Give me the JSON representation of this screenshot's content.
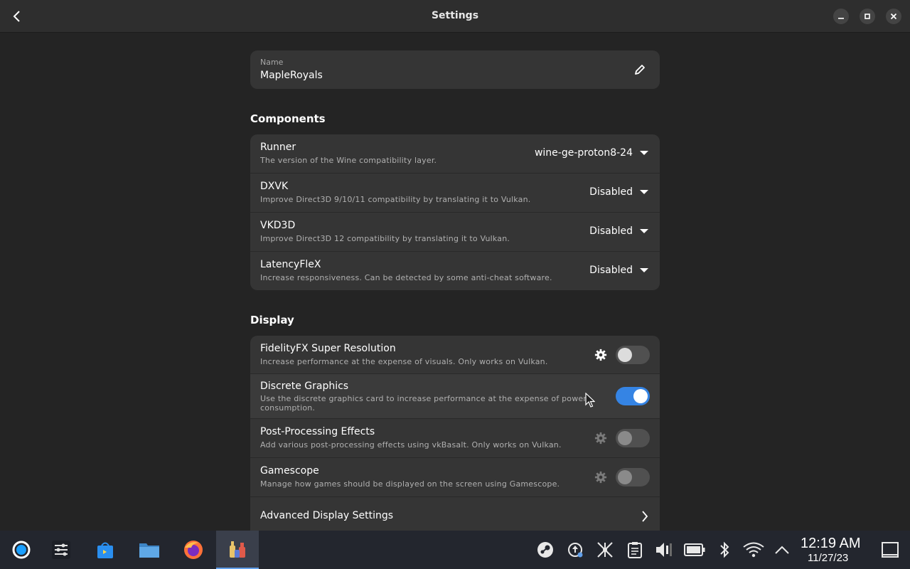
{
  "window": {
    "title": "Settings"
  },
  "name_field": {
    "label": "Name",
    "value": "MapleRoyals"
  },
  "components": {
    "heading": "Components",
    "rows": [
      {
        "title": "Runner",
        "subtitle": "The version of the Wine compatibility layer.",
        "value": "wine-ge-proton8-24"
      },
      {
        "title": "DXVK",
        "subtitle": "Improve Direct3D 9/10/11 compatibility by translating it to Vulkan.",
        "value": "Disabled"
      },
      {
        "title": "VKD3D",
        "subtitle": "Improve Direct3D 12 compatibility by translating it to Vulkan.",
        "value": "Disabled"
      },
      {
        "title": "LatencyFleX",
        "subtitle": "Increase responsiveness. Can be detected by some anti-cheat software.",
        "value": "Disabled"
      }
    ]
  },
  "display": {
    "heading": "Display",
    "rows": [
      {
        "title": "FidelityFX Super Resolution",
        "subtitle": "Increase performance at the expense of visuals. Only works on Vulkan.",
        "enabled": false
      },
      {
        "title": "Discrete Graphics",
        "subtitle": "Use the discrete graphics card to increase performance at the expense of power consumption.",
        "enabled": true
      },
      {
        "title": "Post-Processing Effects",
        "subtitle": "Add various post-processing effects using vkBasalt. Only works on Vulkan.",
        "enabled": false
      },
      {
        "title": "Gamescope",
        "subtitle": "Manage how games should be displayed on the screen using Gamescope.",
        "enabled": false
      }
    ],
    "advanced_label": "Advanced Display Settings"
  },
  "taskbar": {
    "apps": [
      "steam-launcher-icon",
      "settings-sliders-icon",
      "store-icon",
      "file-manager-icon",
      "firefox-icon",
      "bottles-icon"
    ],
    "tray": [
      "steam-icon",
      "update-icon",
      "network-share-icon",
      "clipboard-icon",
      "volume-icon",
      "battery-icon",
      "bluetooth-icon",
      "wifi-icon",
      "chevron-up-icon"
    ],
    "time": "12:19 AM",
    "date": "11/27/23"
  },
  "colors": {
    "accent": "#3584e4",
    "background": "#242424",
    "card": "#353535",
    "taskbar": "#23262e"
  }
}
